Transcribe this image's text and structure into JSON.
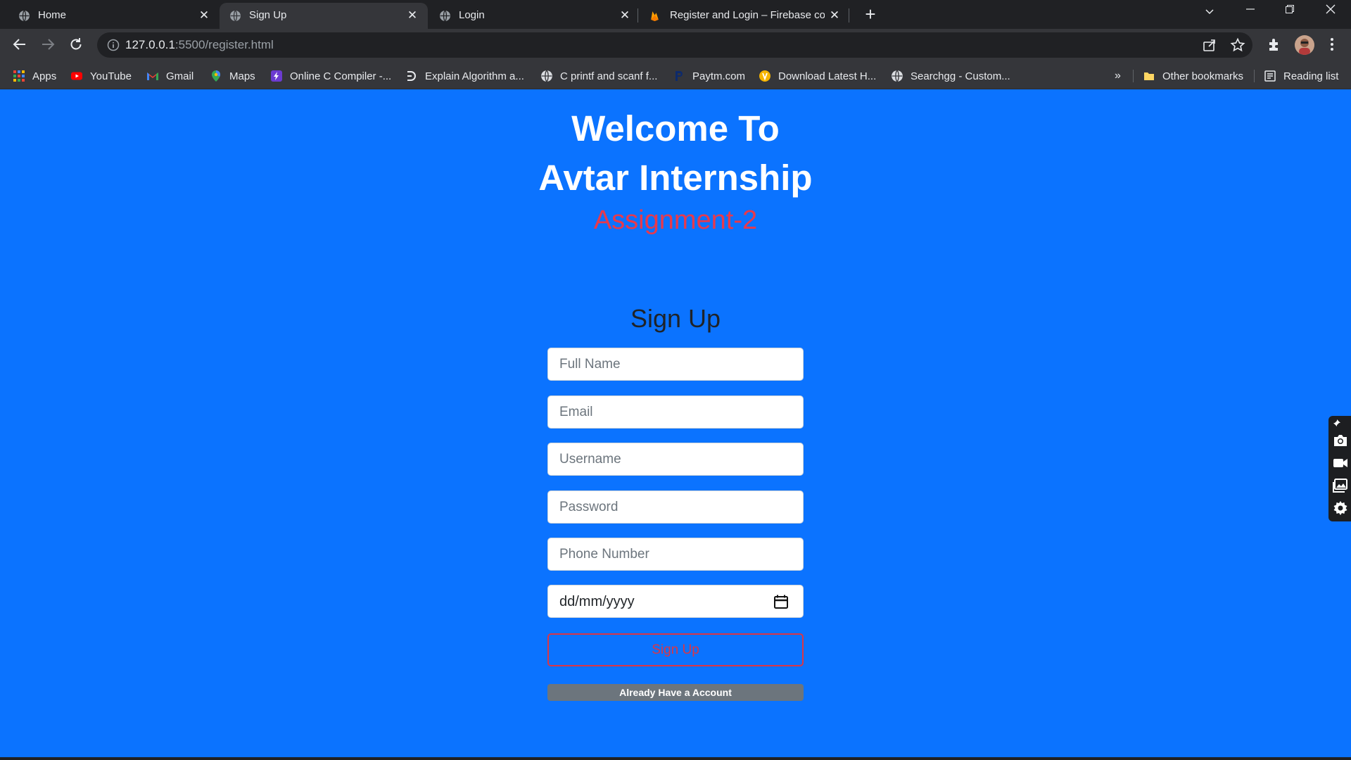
{
  "browser": {
    "tabs": [
      {
        "title": "Home",
        "active": false,
        "icon": "globe-icon"
      },
      {
        "title": "Sign Up",
        "active": true,
        "icon": "globe-icon"
      },
      {
        "title": "Login",
        "active": false,
        "icon": "globe-icon"
      },
      {
        "title": "Register and Login – Firebase cor",
        "active": false,
        "icon": "firebase-icon"
      }
    ],
    "url_host": "127.0.0.1",
    "url_rest": ":5500/register.html",
    "bookmarks": [
      {
        "label": "Apps",
        "icon": "apps-grid-icon"
      },
      {
        "label": "YouTube",
        "icon": "youtube-icon"
      },
      {
        "label": "Gmail",
        "icon": "gmail-icon"
      },
      {
        "label": "Maps",
        "icon": "maps-icon"
      },
      {
        "label": "Online C Compiler -...",
        "icon": "compiler-icon"
      },
      {
        "label": "Explain Algorithm a...",
        "icon": "algorithm-icon"
      },
      {
        "label": "C printf and scanf f...",
        "icon": "globe-icon"
      },
      {
        "label": "Paytm.com",
        "icon": "paytm-icon"
      },
      {
        "label": "Download Latest H...",
        "icon": "download-site-icon"
      },
      {
        "label": "Searchgg - Custom...",
        "icon": "globe-icon"
      }
    ],
    "more_bookmarks": "»",
    "other_bookmarks": "Other bookmarks",
    "reading_list": "Reading list"
  },
  "page": {
    "welcome_line1": "Welcome To",
    "welcome_line2": "Avtar Internship",
    "assignment": "Assignment-2",
    "form_title": "Sign Up",
    "fields": {
      "full_name": "Full Name",
      "email": "Email",
      "username": "Username",
      "password": "Password",
      "phone": "Phone Number",
      "date": "dd/mm/yyyy"
    },
    "signup_button": "Sign Up",
    "have_account_button": "Already Have a Account"
  },
  "colors": {
    "page_background": "#0b73ff",
    "assignment_text": "#e8394c",
    "signup_border": "#dc3545",
    "secondary_button": "#6c757d"
  }
}
